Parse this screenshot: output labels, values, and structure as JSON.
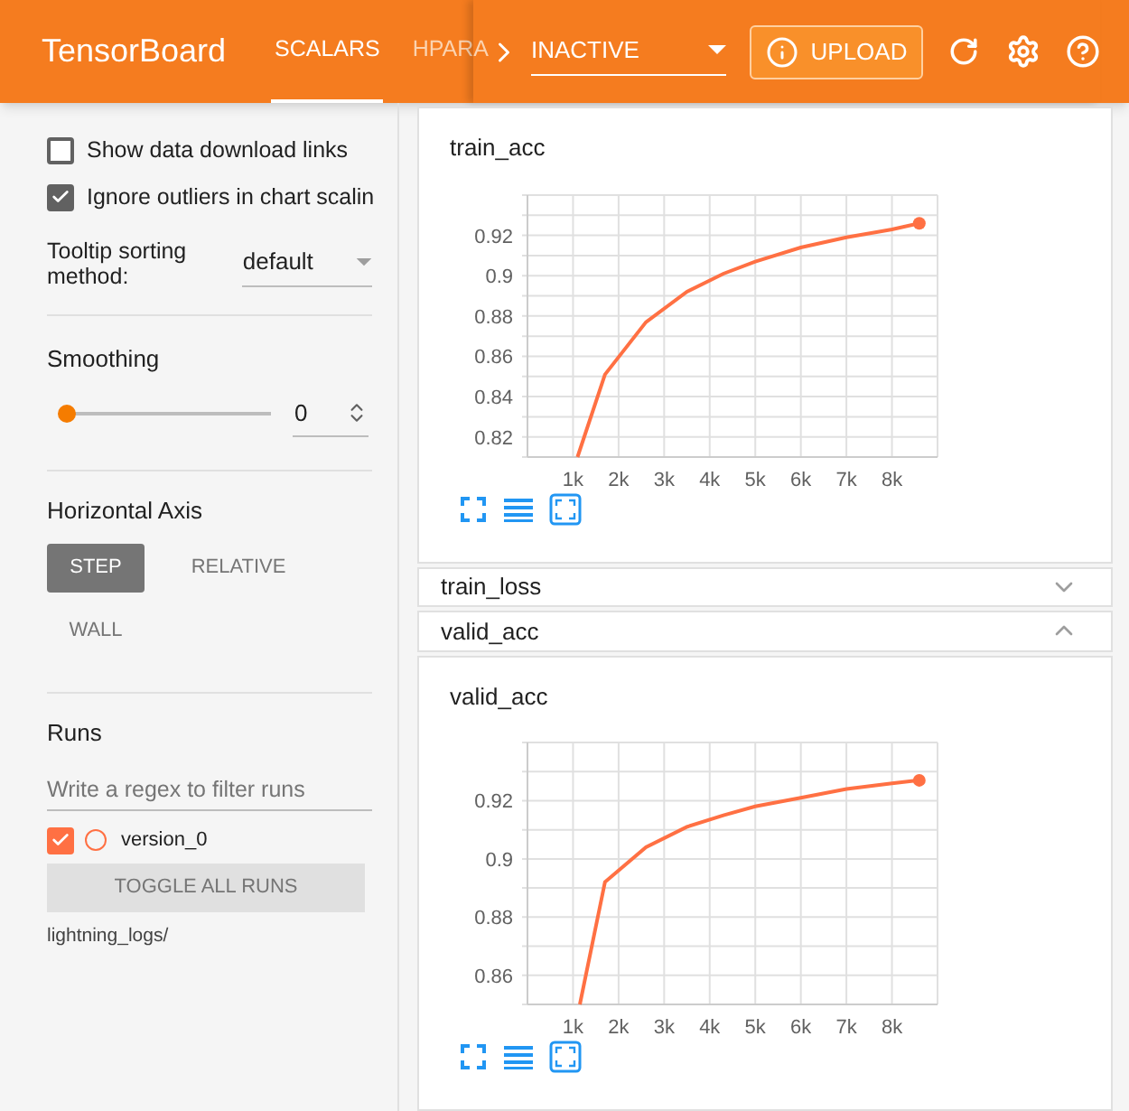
{
  "header": {
    "title": "TensorBoard",
    "tabs": [
      {
        "label": "SCALARS",
        "selected": true
      },
      {
        "label": "HPARA",
        "selected": false
      }
    ],
    "run_selector": {
      "value": "INACTIVE"
    },
    "upload_button": "UPLOAD"
  },
  "sidebar": {
    "checkboxes": [
      {
        "label": "Show data download links",
        "checked": false
      },
      {
        "label": "Ignore outliers in chart scalin",
        "checked": true
      }
    ],
    "tooltip_sorting": {
      "label": "Tooltip sorting method:",
      "value": "default"
    },
    "smoothing": {
      "label": "Smoothing",
      "value": "0",
      "level": 0
    },
    "horizontal_axis": {
      "label": "Horizontal Axis",
      "options": [
        {
          "label": "STEP",
          "selected": true
        },
        {
          "label": "RELATIVE",
          "selected": false
        },
        {
          "label": "WALL",
          "selected": false
        }
      ]
    },
    "runs": {
      "label": "Runs",
      "placeholder": "Write a regex to filter runs",
      "items": [
        {
          "name": "version_0",
          "checked": true,
          "color": "#ff7043"
        }
      ],
      "toggle_button": "TOGGLE ALL RUNS",
      "log_dir": "lightning_logs/"
    }
  },
  "sections": [
    {
      "kind": "chart",
      "title": "train_acc",
      "chart_data": {
        "type": "line",
        "grid": true,
        "x": [
          1100,
          1700,
          2600,
          3500,
          4300,
          5000,
          6000,
          7000,
          8000,
          8600
        ],
        "series": [
          {
            "color": "#ff7043",
            "values": [
              0.81,
              0.851,
              0.877,
              0.892,
              0.901,
              0.907,
              0.914,
              0.919,
              0.923,
              0.926
            ]
          }
        ],
        "xlim": [
          0,
          9000
        ],
        "ylim": [
          0.81,
          0.94
        ],
        "xticks": [
          {
            "value": 1000,
            "label": "1k"
          },
          {
            "value": 2000,
            "label": "2k"
          },
          {
            "value": 3000,
            "label": "3k"
          },
          {
            "value": 4000,
            "label": "4k"
          },
          {
            "value": 5000,
            "label": "5k"
          },
          {
            "value": 6000,
            "label": "6k"
          },
          {
            "value": 7000,
            "label": "7k"
          },
          {
            "value": 8000,
            "label": "8k"
          }
        ],
        "yticks": [
          0.82,
          0.84,
          0.86,
          0.88,
          {
            "value": 0.9,
            "label": "0.9"
          },
          0.92
        ]
      }
    },
    {
      "kind": "group",
      "title": "train_loss",
      "expanded": false
    },
    {
      "kind": "group",
      "title": "valid_acc",
      "expanded": true
    },
    {
      "kind": "chart",
      "title": "valid_acc",
      "chart_data": {
        "type": "line",
        "grid": true,
        "x": [
          1150,
          1700,
          2600,
          3500,
          4300,
          5000,
          6000,
          7000,
          8000,
          8600
        ],
        "series": [
          {
            "color": "#ff7043",
            "values": [
              0.85,
              0.892,
              0.904,
              0.911,
              0.915,
              0.918,
              0.921,
              0.924,
              0.926,
              0.927
            ]
          }
        ],
        "xlim": [
          0,
          9000
        ],
        "ylim": [
          0.85,
          0.94
        ],
        "xticks": [
          {
            "value": 1000,
            "label": "1k"
          },
          {
            "value": 2000,
            "label": "2k"
          },
          {
            "value": 3000,
            "label": "3k"
          },
          {
            "value": 4000,
            "label": "4k"
          },
          {
            "value": 5000,
            "label": "5k"
          },
          {
            "value": 6000,
            "label": "6k"
          },
          {
            "value": 7000,
            "label": "7k"
          },
          {
            "value": 8000,
            "label": "8k"
          }
        ],
        "yticks": [
          0.86,
          0.88,
          {
            "value": 0.9,
            "label": "0.9"
          },
          0.92
        ]
      }
    }
  ]
}
